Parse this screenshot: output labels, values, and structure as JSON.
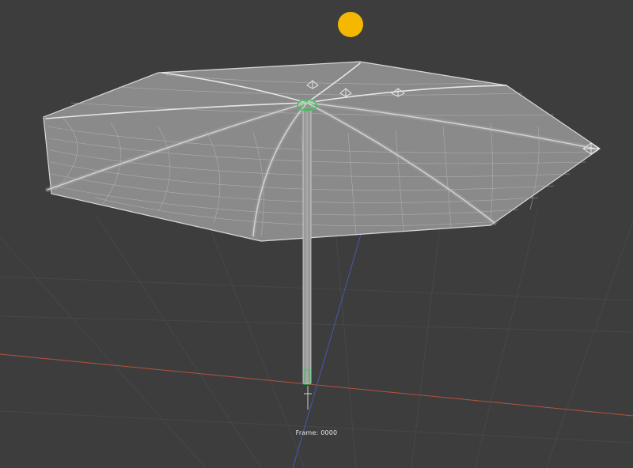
{
  "viewport": {
    "frame_label": "Frame: 0000",
    "background_color": "#3d3d3d",
    "grid_color": "#4a4a4a",
    "x_axis_color": "#b5533c",
    "y_axis_color": "#4a57b0",
    "wire_color": "#d0d0d0",
    "canopy_fill": "#8a8a8a",
    "selection_color": "#33cc55",
    "light_color": "#f5b800"
  },
  "scene": {
    "objects": [
      {
        "name": "umbrella-canopy",
        "type": "mesh",
        "mode": "wireframe"
      },
      {
        "name": "umbrella-pole",
        "type": "mesh",
        "mode": "wireframe"
      },
      {
        "name": "sun-light",
        "type": "light",
        "icon": "sun-light-icon"
      },
      {
        "name": "empty-markers",
        "type": "empty",
        "icon": "empty-marker-icon"
      }
    ]
  }
}
